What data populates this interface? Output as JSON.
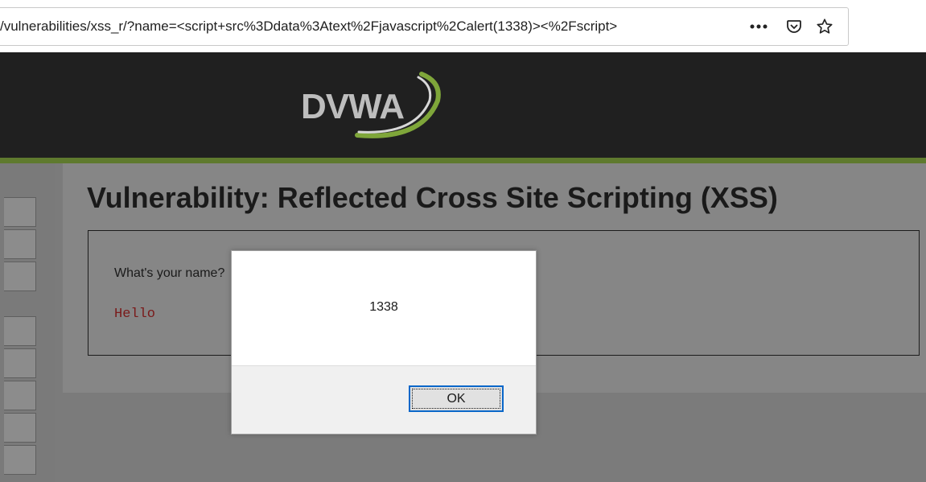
{
  "browser": {
    "url": "/vulnerabilities/xss_r/?name=<script+src%3Ddata%3Atext%2Fjavascript%2Calert(1338)><%2Fscript>",
    "icons": [
      "more-icon",
      "pocket-icon",
      "bookmark-star-icon"
    ]
  },
  "header": {
    "logo_text": "DVWA",
    "accent_color": "#5f7a2e"
  },
  "main": {
    "title": "Vulnerability: Reflected Cross Site Scripting (XSS)",
    "question": "What's your name?",
    "hello": "Hello"
  },
  "alert": {
    "message": "1338",
    "ok_label": "OK"
  }
}
